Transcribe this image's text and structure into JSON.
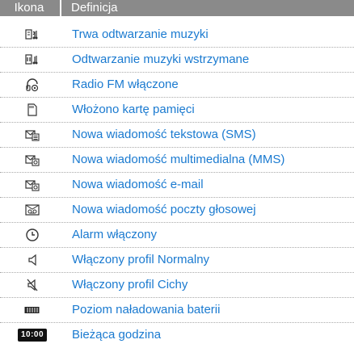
{
  "header": {
    "icon_col": "Ikona",
    "def_col": "Definicja"
  },
  "rows": [
    {
      "icon": "music-playing-icon",
      "label": "Trwa odtwarzanie muzyki"
    },
    {
      "icon": "music-paused-icon",
      "label": "Odtwarzanie muzyki wstrzymane"
    },
    {
      "icon": "fm-radio-icon",
      "label": "Radio FM włączone"
    },
    {
      "icon": "memory-card-icon",
      "label": "Włożono kartę pamięci"
    },
    {
      "icon": "sms-icon",
      "label": "Nowa wiadomość tekstowa (SMS)"
    },
    {
      "icon": "mms-icon",
      "label": "Nowa wiadomość multimedialna (MMS)"
    },
    {
      "icon": "email-icon",
      "label": "Nowa wiadomość e-mail"
    },
    {
      "icon": "voicemail-icon",
      "label": "Nowa wiadomość poczty głosowej"
    },
    {
      "icon": "alarm-icon",
      "label": "Alarm włączony"
    },
    {
      "icon": "speaker-icon",
      "label": "Włączony profil Normalny"
    },
    {
      "icon": "silent-icon",
      "label": "Włączony profil Cichy"
    },
    {
      "icon": "battery-icon",
      "label": "Poziom naładowania baterii"
    },
    {
      "icon": "clock-icon",
      "label": "Bieżąca godzina",
      "time": "10:00"
    }
  ],
  "colors": {
    "header_bg": "#8a8a8a",
    "label_text": "#1a7ad0"
  }
}
